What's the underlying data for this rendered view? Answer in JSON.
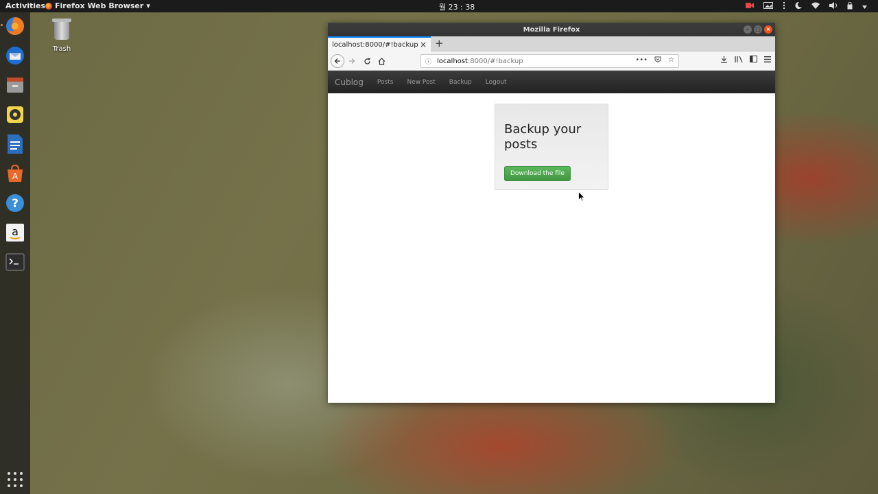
{
  "topbar": {
    "activities": "Activities",
    "app_menu": "Firefox Web Browser",
    "app_menu_arrow": "▾",
    "clock": "월 23 : 38"
  },
  "desktop": {
    "trash_label": "Trash"
  },
  "window": {
    "title": "Mozilla Firefox",
    "tab_title": "localhost:8000/#!backup",
    "url_host": "localhost",
    "url_path": ":8000/#!backup"
  },
  "site": {
    "brand": "Cublog",
    "nav": [
      "Posts",
      "New Post",
      "Backup",
      "Logout"
    ],
    "heading": "Backup your posts",
    "download_button": "Download the file"
  },
  "colors": {
    "accent_tab": "#0a84ff",
    "success_button": "#5cb85c",
    "navbar": "#222222"
  }
}
